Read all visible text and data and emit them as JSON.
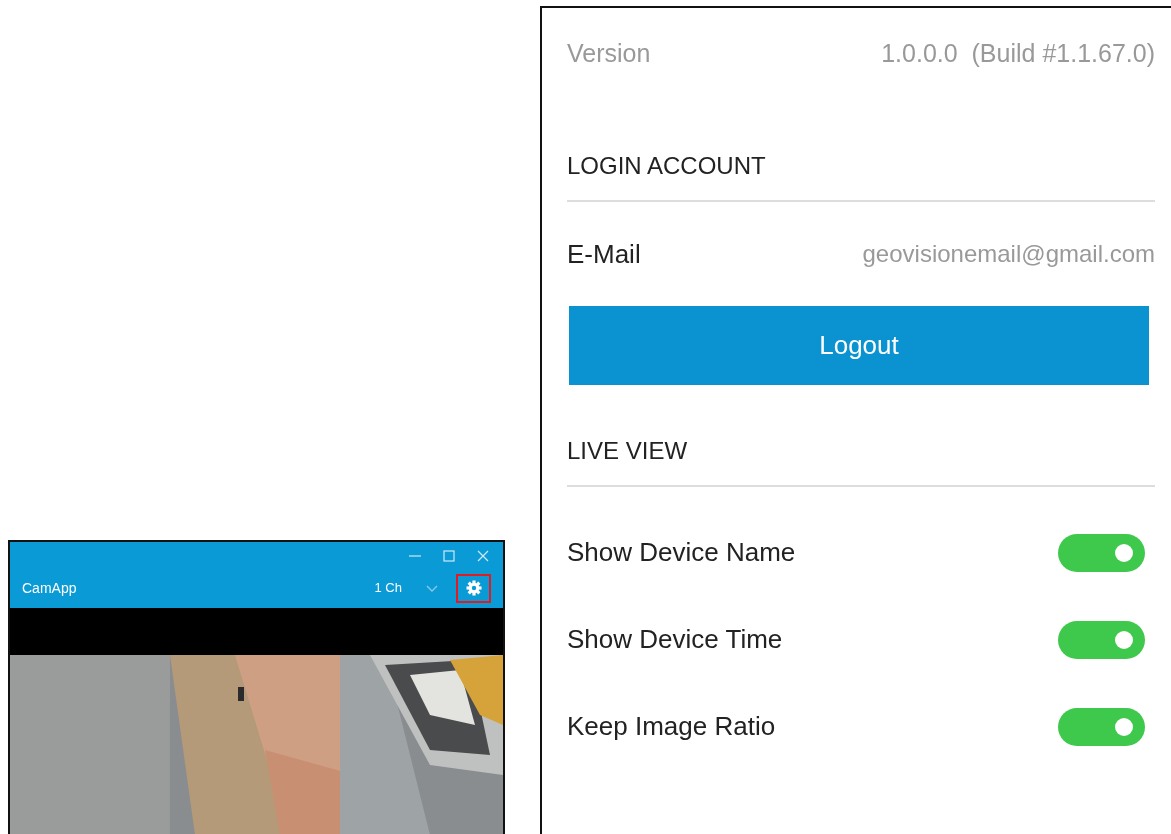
{
  "camera_window": {
    "title": "CamApp",
    "channel_select": {
      "value": "1 Ch"
    },
    "settings_button": {
      "highlighted": true
    }
  },
  "settings": {
    "version": {
      "label": "Version",
      "value": "1.0.0.0  (Build #1.1.67.0)"
    },
    "sections": [
      {
        "title": "LOGIN ACCOUNT",
        "items": [
          {
            "kind": "field",
            "label": "E-Mail",
            "value": "geovisionemail@gmail.com"
          },
          {
            "kind": "button",
            "label": "Logout"
          }
        ]
      },
      {
        "title": "LIVE VIEW",
        "items": [
          {
            "kind": "toggle",
            "label": "Show Device Name",
            "on": true
          },
          {
            "kind": "toggle",
            "label": "Show Device Time",
            "on": true
          },
          {
            "kind": "toggle",
            "label": "Keep Image Ratio",
            "on": true
          }
        ]
      }
    ]
  }
}
